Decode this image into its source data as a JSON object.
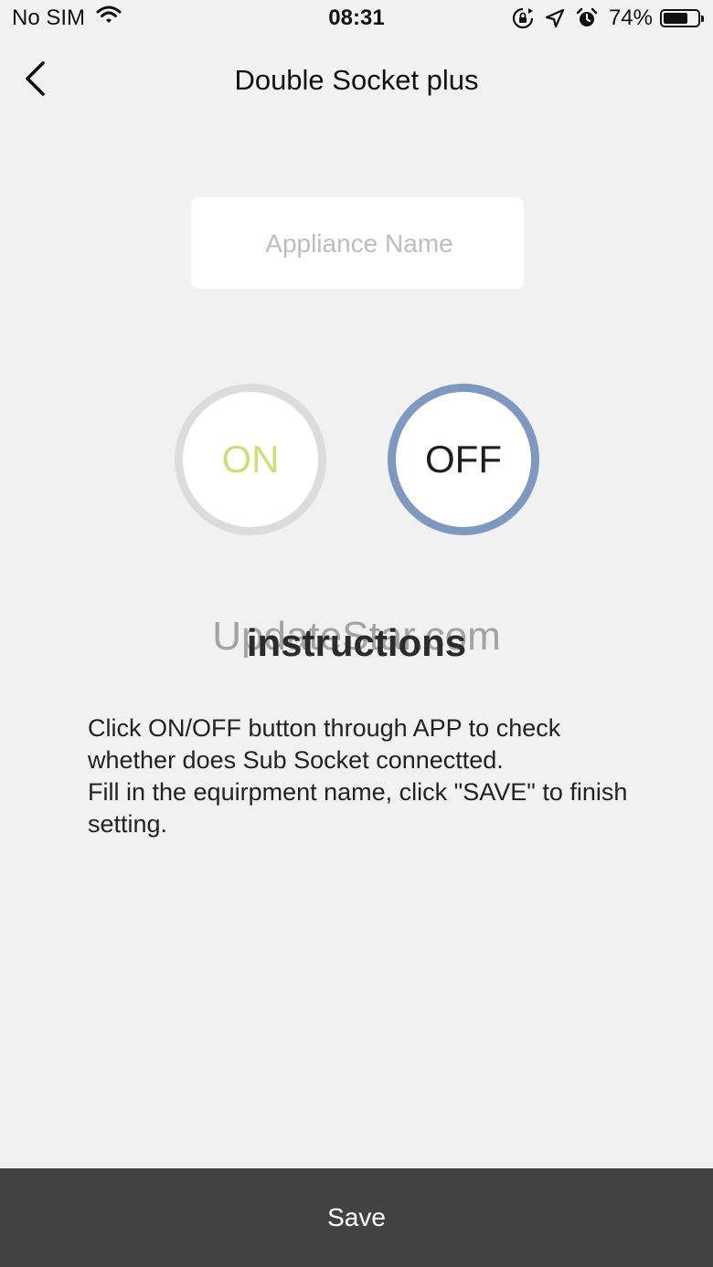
{
  "status_bar": {
    "carrier": "No SIM",
    "time": "08:31",
    "battery_percent": "74%",
    "battery_level": 0.74,
    "icons": [
      "wifi-icon",
      "rotation-lock-icon",
      "location-icon",
      "alarm-icon",
      "battery-icon"
    ]
  },
  "nav": {
    "title": "Double Socket plus",
    "back_icon": "chevron-left-icon"
  },
  "appliance": {
    "value": "",
    "placeholder": "Appliance Name"
  },
  "switch": {
    "on_label": "ON",
    "off_label": "OFF",
    "selected": "OFF",
    "on_color": "#cbe07a",
    "off_ring_color": "#7f98c0"
  },
  "watermark": "UpdateStar.com",
  "instructions": {
    "title": "instructions",
    "line1": "Click ON/OFF button through APP to check whether does Sub Socket connectted.",
    "line2": "Fill in the equirpment name, click \"SAVE\" to finish setting."
  },
  "footer": {
    "save_label": "Save",
    "background": "#434343"
  }
}
